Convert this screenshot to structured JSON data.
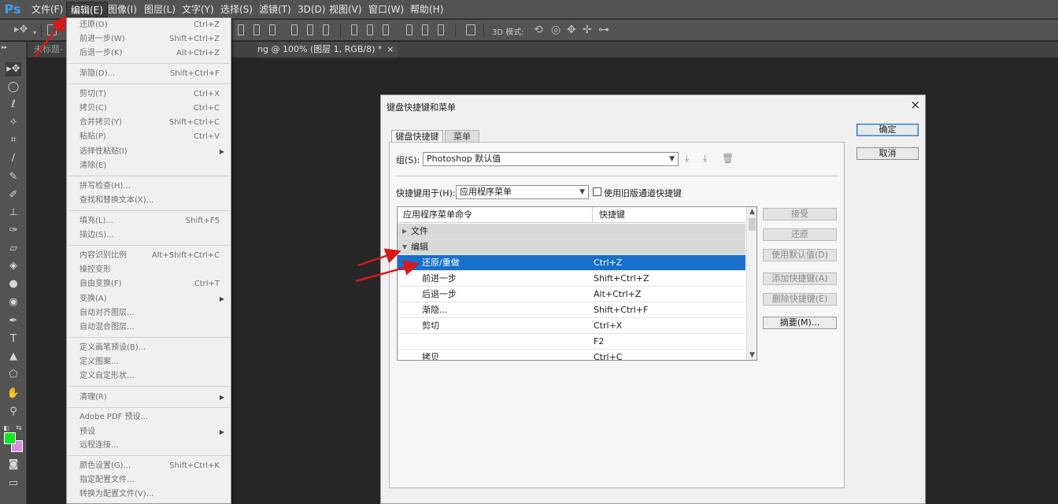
{
  "app": {
    "logo": "Ps"
  },
  "menubar": {
    "items": [
      "文件(F)",
      "编辑(E)",
      "图像(I)",
      "图层(L)",
      "文字(Y)",
      "选择(S)",
      "滤镜(T)",
      "3D(D)",
      "视图(V)",
      "窗口(W)",
      "帮助(H)"
    ],
    "active_index": 1
  },
  "options_bar": {
    "mode_3d_label": "3D 模式:"
  },
  "document": {
    "tab_left_partial": "未标题-",
    "tab_title": "ng @ 100% (图层 1, RGB/8) *",
    "tab_close": "×"
  },
  "edit_menu": {
    "items": [
      {
        "label": "还原(O)",
        "shortcut": "Ctrl+Z"
      },
      {
        "label": "前进一步(W)",
        "shortcut": "Shift+Ctrl+Z"
      },
      {
        "label": "后退一步(K)",
        "shortcut": "Alt+Ctrl+Z"
      },
      {
        "label": "渐隐(D)...",
        "shortcut": "Shift+Ctrl+F"
      },
      {
        "label": "剪切(T)",
        "shortcut": "Ctrl+X"
      },
      {
        "label": "拷贝(C)",
        "shortcut": "Ctrl+C"
      },
      {
        "label": "合并拷贝(Y)",
        "shortcut": "Shift+Ctrl+C"
      },
      {
        "label": "粘贴(P)",
        "shortcut": "Ctrl+V"
      },
      {
        "label": "选择性粘贴(I)",
        "shortcut": ""
      },
      {
        "label": "清除(E)",
        "shortcut": ""
      },
      {
        "label": "拼写检查(H)...",
        "shortcut": ""
      },
      {
        "label": "查找和替换文本(X)...",
        "shortcut": ""
      },
      {
        "label": "填充(L)...",
        "shortcut": "Shift+F5"
      },
      {
        "label": "描边(S)...",
        "shortcut": ""
      },
      {
        "label": "内容识别比例",
        "shortcut": "Alt+Shift+Ctrl+C"
      },
      {
        "label": "操控变形",
        "shortcut": ""
      },
      {
        "label": "自由变换(F)",
        "shortcut": "Ctrl+T"
      },
      {
        "label": "变换(A)",
        "shortcut": ""
      },
      {
        "label": "自动对齐图层...",
        "shortcut": ""
      },
      {
        "label": "自动混合图层...",
        "shortcut": ""
      },
      {
        "label": "定义画笔预设(B)...",
        "shortcut": ""
      },
      {
        "label": "定义图案...",
        "shortcut": ""
      },
      {
        "label": "定义自定形状...",
        "shortcut": ""
      },
      {
        "label": "清理(R)",
        "shortcut": ""
      },
      {
        "label": "Adobe PDF 预设...",
        "shortcut": ""
      },
      {
        "label": "预设",
        "shortcut": ""
      },
      {
        "label": "远程连接...",
        "shortcut": ""
      },
      {
        "label": "颜色设置(G)...",
        "shortcut": "Shift+Ctrl+K"
      },
      {
        "label": "指定配置文件...",
        "shortcut": ""
      },
      {
        "label": "转换为配置文件(V)...",
        "shortcut": ""
      }
    ]
  },
  "dialog": {
    "title": "键盘快捷键和菜单",
    "close": "×",
    "tabs": [
      "键盘快捷键",
      "菜单"
    ],
    "group_label": "组(S):",
    "group_value": "Photoshop 默认值",
    "shortcuts_for_label": "快捷键用于(H):",
    "shortcuts_for_value": "应用程序菜单",
    "legacy_checkbox_label": "使用旧版通道快捷键",
    "table": {
      "headers": [
        "应用程序菜单命令",
        "快捷键"
      ],
      "rows": [
        {
          "cmd": "文件",
          "key": "",
          "type": "group-collapsed"
        },
        {
          "cmd": "编辑",
          "key": "",
          "type": "group-expanded"
        },
        {
          "cmd": "还原/重做",
          "key": "Ctrl+Z",
          "type": "selected"
        },
        {
          "cmd": "前进一步",
          "key": "Shift+Ctrl+Z",
          "type": "item"
        },
        {
          "cmd": "后退一步",
          "key": "Alt+Ctrl+Z",
          "type": "item"
        },
        {
          "cmd": "渐隐...",
          "key": "Shift+Ctrl+F",
          "type": "item"
        },
        {
          "cmd": "剪切",
          "key": "Ctrl+X",
          "type": "item"
        },
        {
          "cmd": "",
          "key": "F2",
          "type": "item"
        },
        {
          "cmd": "拷贝",
          "key": "Ctrl+C",
          "type": "item"
        }
      ]
    },
    "side_buttons": {
      "accept": "接受",
      "undo": "还原",
      "use_default": "使用默认值(D)",
      "add_shortcut": "添加快捷键(A)",
      "delete_shortcut": "删除快捷键(E)",
      "summarize": "摘要(M)..."
    },
    "ok": "确定",
    "cancel": "取消"
  },
  "colors": {
    "foreground": "#11e81b",
    "background": "#d88edc",
    "selection": "#1770cc",
    "annotation_arrow": "#d81919"
  }
}
